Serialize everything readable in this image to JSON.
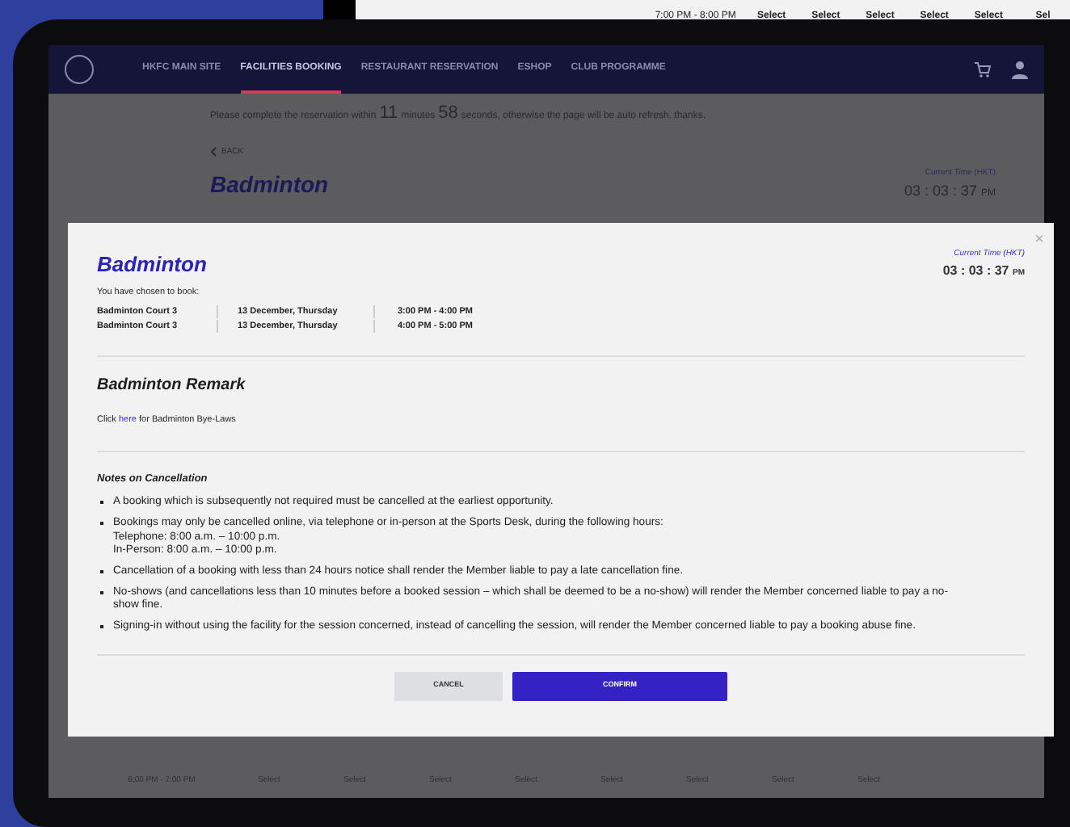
{
  "background_row": {
    "time": "7:00 PM - 8:00 PM",
    "cells": [
      "Select",
      "Select",
      "Select",
      "Select",
      "Select",
      "Sel"
    ]
  },
  "nav": {
    "items": [
      {
        "label": "HKFC MAIN SITE",
        "selected": false
      },
      {
        "label": "FACILITIES BOOKING",
        "selected": true
      },
      {
        "label": "RESTAURANT RESERVATION",
        "selected": false
      },
      {
        "label": "ESHOP",
        "selected": false
      },
      {
        "label": "CLUB PROGRAMME",
        "selected": false
      }
    ]
  },
  "page": {
    "notice": [
      {
        "kind": "text",
        "text": "Please complete the reservation within"
      },
      {
        "kind": "number",
        "text": "11"
      },
      {
        "kind": "text",
        "text": "minutes"
      },
      {
        "kind": "number",
        "text": "58"
      },
      {
        "kind": "text",
        "text": "seconds, otherwise the page will be auto refresh. thanks."
      }
    ],
    "back": "BACK",
    "title": "Badminton",
    "time_label": "Current Time (HKT)",
    "time": "03 : 03 : 37",
    "time_suffix": "PM",
    "bottom_row": {
      "time": "6:00 PM - 7:00 PM",
      "cells": [
        "Select",
        "Select",
        "Select",
        "Select",
        "Select",
        "Select",
        "Select",
        "Select"
      ]
    }
  },
  "modal": {
    "title": "Badminton",
    "time_label": "Current Time (HKT)",
    "time": "03 : 03 : 37",
    "time_suffix": "PM",
    "close": "×",
    "intro": "You have chosen to book:",
    "bookings": [
      {
        "court": "Badminton Court 3",
        "date": "13 December, Thursday",
        "time": "3:00 PM - 4:00 PM"
      },
      {
        "court": "Badminton Court 3",
        "date": "13 December, Thursday",
        "time": "4:00 PM - 5:00 PM"
      }
    ],
    "remark_title": "Badminton Remark",
    "remark": {
      "before": "Click",
      "link": "here",
      "after": "for Badminton Bye-Laws"
    },
    "notes_title": "Notes on Cancellation",
    "notes": [
      {
        "lines": [
          "A booking which is subsequently not required must be cancelled at the earliest opportunity."
        ]
      },
      {
        "lines": [
          "Bookings may only be cancelled online, via telephone or in-person at the Sports Desk, during the following hours:",
          "Telephone: 8:00 a.m. – 10:00 p.m.",
          "In-Person: 8:00 a.m. – 10:00 p.m."
        ]
      },
      {
        "lines": [
          "Cancellation of a booking with less than 24 hours notice shall render the Member liable to pay a late cancellation fine."
        ]
      },
      {
        "lines": [
          "No-shows (and cancellations less than 10 minutes before a booked session – which shall be deemed to be a no-show) will render the Member concerned liable to pay a no-show fine."
        ]
      },
      {
        "lines": [
          "Signing-in without using the facility for the session concerned, instead of cancelling the session, will render the Member concerned liable to pay a booking abuse fine."
        ]
      }
    ],
    "buttons": {
      "cancel": "CANCEL",
      "confirm": "CONFIRM"
    }
  }
}
